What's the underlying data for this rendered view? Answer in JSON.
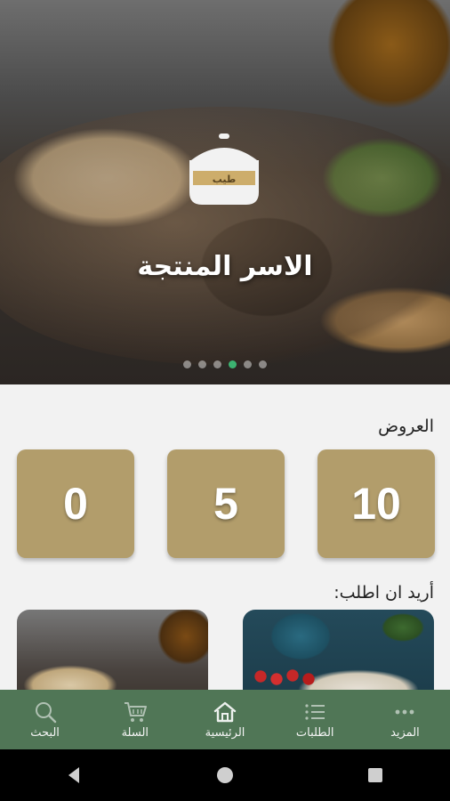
{
  "hero": {
    "title": "الاسر المنتجة",
    "logo_text": "طيب",
    "slides_count": 6,
    "active_slide": 4
  },
  "offers": {
    "label": "العروض",
    "values": [
      "10",
      "5",
      "0"
    ]
  },
  "order_section": {
    "label": "أريد ان اطلب:"
  },
  "bottom_nav": {
    "items": [
      {
        "label": "المزيد",
        "icon": "more-dots-icon"
      },
      {
        "label": "الطلبات",
        "icon": "list-icon"
      },
      {
        "label": "الرئيسية",
        "icon": "home-icon"
      },
      {
        "label": "السلة",
        "icon": "cart-icon"
      },
      {
        "label": "البحث",
        "icon": "search-icon"
      }
    ]
  },
  "colors": {
    "accent_gold": "#b29d6b",
    "nav_green": "#507656",
    "active_dot": "#3cb371"
  }
}
